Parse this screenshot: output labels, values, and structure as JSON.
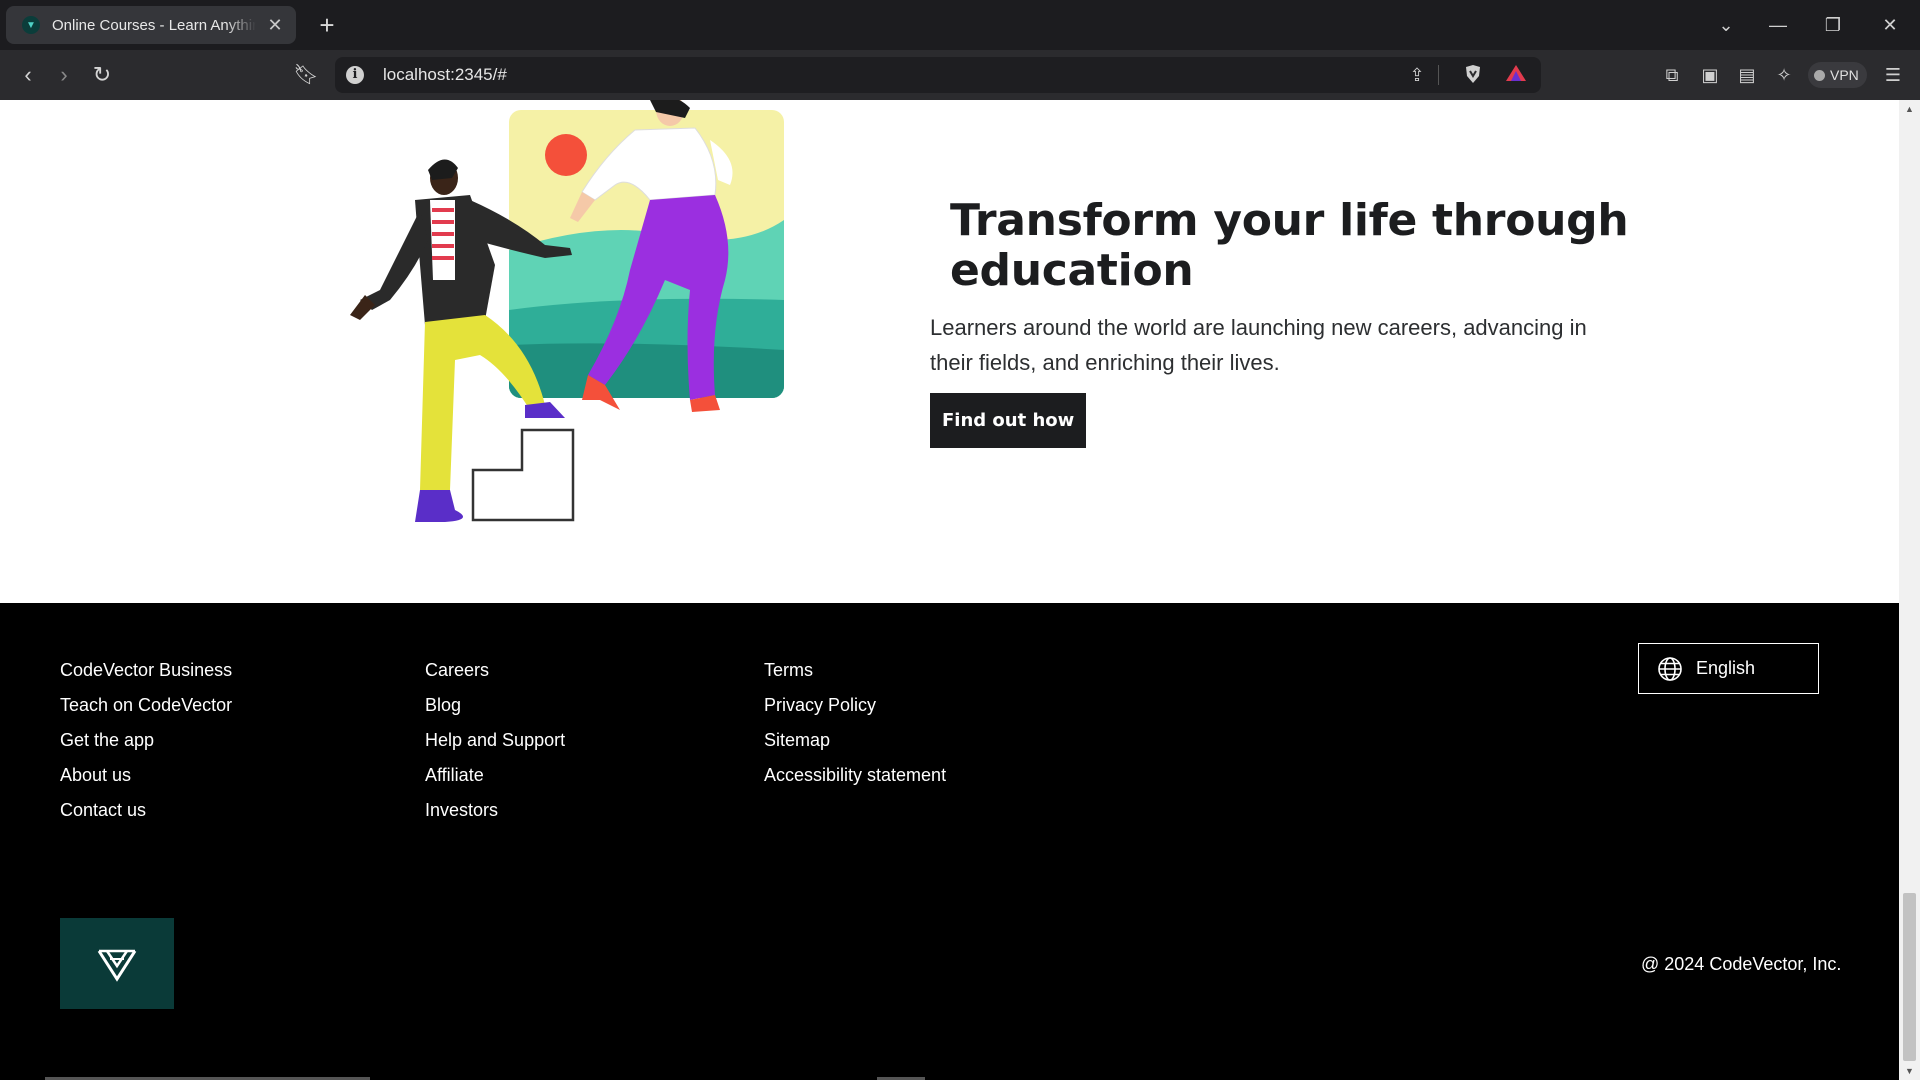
{
  "browser": {
    "tab_title": "Online Courses - Learn Anything",
    "tab_favicon": "codevector-favicon",
    "url": "localhost:2345/#",
    "vpn_label": "VPN"
  },
  "hero": {
    "title": "Transform your life through education",
    "description": "Learners around the world are launching new careers, advancing in their fields, and enriching their lives.",
    "button_label": "Find out how"
  },
  "footer": {
    "col1": [
      "CodeVector Business",
      "Teach on CodeVector",
      "Get the app",
      "About us",
      "Contact us"
    ],
    "col2": [
      "Careers",
      "Blog",
      "Help and Support",
      "Affiliate",
      "Investors"
    ],
    "col3": [
      "Terms",
      "Privacy Policy",
      "Sitemap",
      "Accessibility statement"
    ],
    "language": "English",
    "copyright": "@ 2024 CodeVector, Inc."
  },
  "colors": {
    "footer_bg": "#000000",
    "button_bg": "#1c1d1f",
    "logo_bg": "#0a3a38",
    "illustration_teal": "#5fd3b5",
    "illustration_purple": "#9b2fe0",
    "illustration_yellow": "#e4e23a",
    "illustration_sun": "#f4503a"
  }
}
